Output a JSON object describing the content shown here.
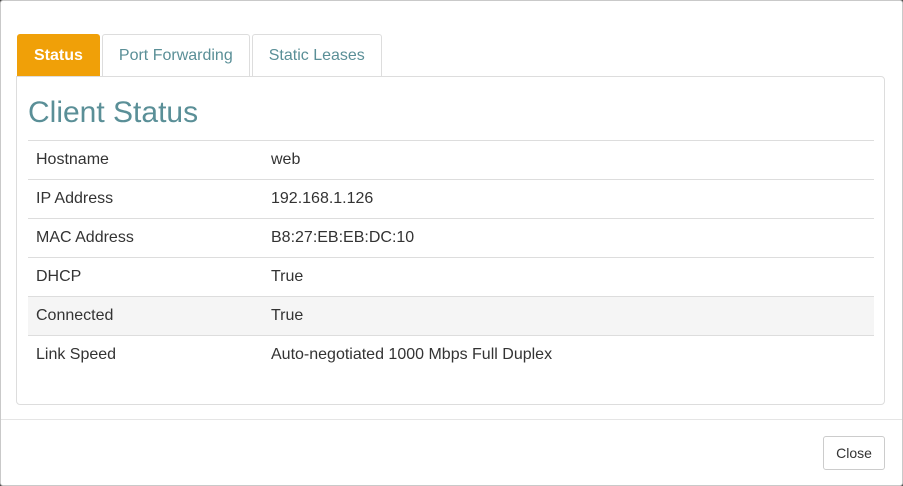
{
  "tabs": [
    {
      "label": "Status",
      "active": true
    },
    {
      "label": "Port Forwarding",
      "active": false
    },
    {
      "label": "Static Leases",
      "active": false
    }
  ],
  "panel": {
    "title": "Client Status",
    "rows": [
      {
        "key": "Hostname",
        "value": "web"
      },
      {
        "key": "IP Address",
        "value": "192.168.1.126"
      },
      {
        "key": "MAC Address",
        "value": "B8:27:EB:EB:DC:10"
      },
      {
        "key": "DHCP",
        "value": "True"
      },
      {
        "key": "Connected",
        "value": "True"
      },
      {
        "key": "Link Speed",
        "value": "Auto-negotiated 1000 Mbps Full Duplex"
      }
    ]
  },
  "footer": {
    "close_label": "Close"
  },
  "colors": {
    "accent": "#f0a008",
    "title": "#5a8f97"
  }
}
